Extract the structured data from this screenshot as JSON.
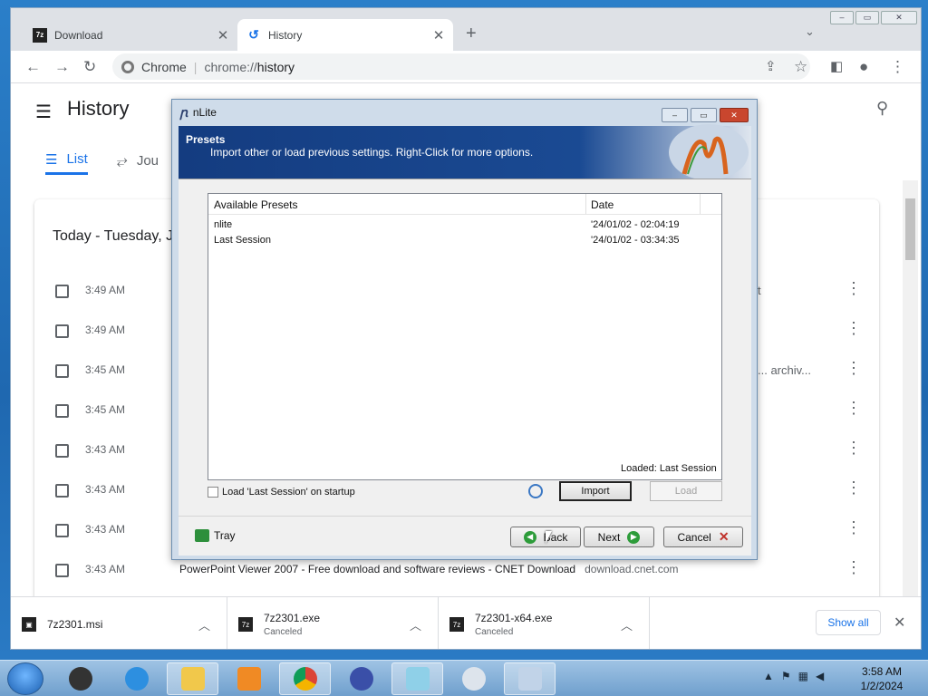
{
  "browser": {
    "tabs": [
      {
        "label": "Download",
        "favicon": "7z-icon",
        "active": false
      },
      {
        "label": "History",
        "favicon": "history-icon",
        "active": true
      }
    ],
    "omnibox_site": "Chrome",
    "omnibox_url_prefix": "chrome://",
    "omnibox_url_path": "history"
  },
  "history": {
    "title": "History",
    "tabs": [
      "List",
      "Jou"
    ],
    "day_heading": "Today - Tuesday, J",
    "rows": [
      {
        "time": "3:49 AM",
        "page": "",
        "extra": "t"
      },
      {
        "time": "3:49 AM",
        "page": "",
        "extra": ""
      },
      {
        "time": "3:45 AM",
        "page": "",
        "extra": "... archiv..."
      },
      {
        "time": "3:45 AM",
        "page": "",
        "extra": ""
      },
      {
        "time": "3:43 AM",
        "page": "",
        "extra": ""
      },
      {
        "time": "3:43 AM",
        "page": "",
        "extra": ""
      },
      {
        "time": "3:43 AM",
        "page": "",
        "extra": ""
      },
      {
        "time": "3:43 AM",
        "page": "PowerPoint Viewer 2007 - Free download and software reviews - CNET Download",
        "site": "download.cnet.com",
        "extra": ""
      }
    ]
  },
  "downloads": [
    {
      "name": "7z2301.msi",
      "status": ""
    },
    {
      "name": "7z2301.exe",
      "status": "Canceled"
    },
    {
      "name": "7z2301-x64.exe",
      "status": "Canceled"
    }
  ],
  "show_all": "Show all",
  "nlite": {
    "title": "nLite",
    "banner_title": "Presets",
    "banner_subtitle": "Import other or load previous settings. Right-Click for more options.",
    "columns": [
      "Available Presets",
      "Date"
    ],
    "presets": [
      {
        "name": "nlite",
        "date": "'24/01/02 - 02:04:19"
      },
      {
        "name": "Last Session",
        "date": "'24/01/02 - 03:34:35"
      }
    ],
    "loaded_text": "Loaded: Last Session",
    "startup_checkbox": "Load 'Last Session' on startup",
    "import_label": "Import",
    "load_label": "Load",
    "tray_label": "Tray",
    "back_label": "Back",
    "next_label": "Next",
    "cancel_label": "Cancel"
  },
  "clock": {
    "time": "3:58 AM",
    "date": "1/2/2024"
  },
  "colors": {
    "accent": "#1a73e8",
    "banner": "#1a4a93"
  }
}
